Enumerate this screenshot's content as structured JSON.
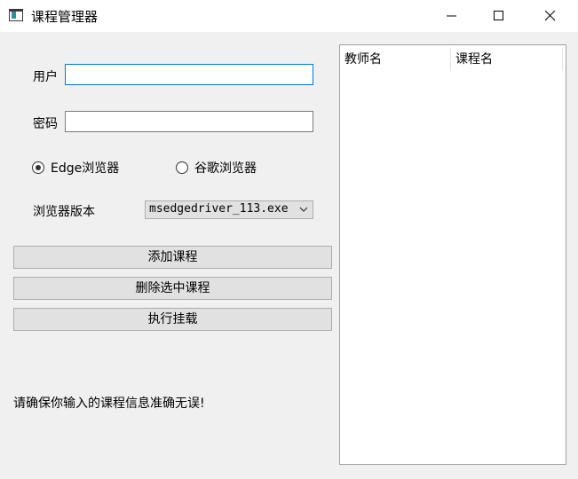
{
  "window": {
    "title": "课程管理器"
  },
  "form": {
    "user_label": "用户",
    "user_value": "",
    "password_label": "密码",
    "password_value": "",
    "browser_options": [
      {
        "label": "Edge浏览器",
        "selected": true
      },
      {
        "label": "谷歌浏览器",
        "selected": false
      }
    ],
    "browser_version_label": "浏览器版本",
    "browser_version_value": "msedgedriver_113.exe"
  },
  "buttons": {
    "add_course": "添加课程",
    "delete_selected": "删除选中课程",
    "execute": "执行挂载"
  },
  "notice": "请确保你输入的课程信息准确无误!",
  "table": {
    "columns": [
      "教师名",
      "课程名"
    ],
    "rows": []
  },
  "colors": {
    "focus_border": "#0078d7",
    "button_bg": "#e1e1e1",
    "window_bg": "#f0f0f0"
  }
}
